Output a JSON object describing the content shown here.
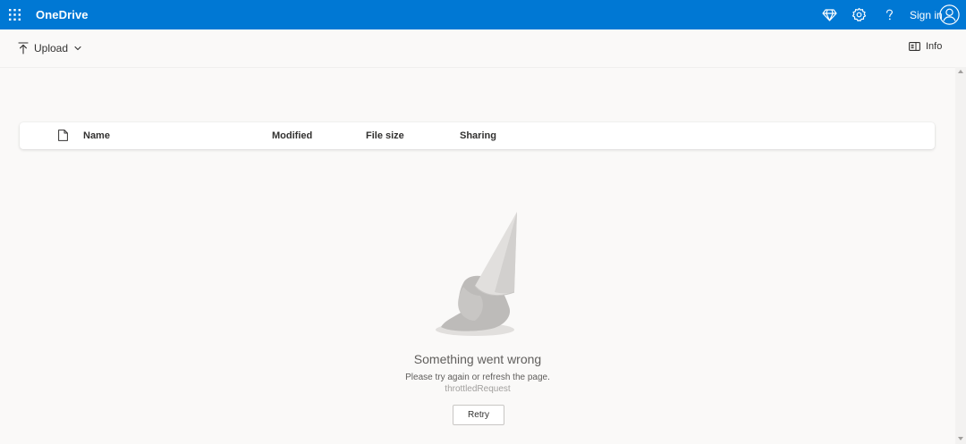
{
  "app": {
    "name": "OneDrive",
    "brand_color": "#0078d4"
  },
  "header": {
    "icons": [
      "app-launcher-icon",
      "premium-diamond-icon",
      "settings-gear-icon",
      "help-question-icon",
      "person-icon"
    ],
    "signin_label": "Sign in"
  },
  "commandbar": {
    "upload_label": "Upload",
    "info_label": "Info"
  },
  "list": {
    "columns": [
      "Name",
      "Modified",
      "File size",
      "Sharing"
    ]
  },
  "error": {
    "title": "Something went wrong",
    "message": "Please try again or refresh the page.",
    "code": "throttledRequest",
    "retry_label": "Retry"
  }
}
